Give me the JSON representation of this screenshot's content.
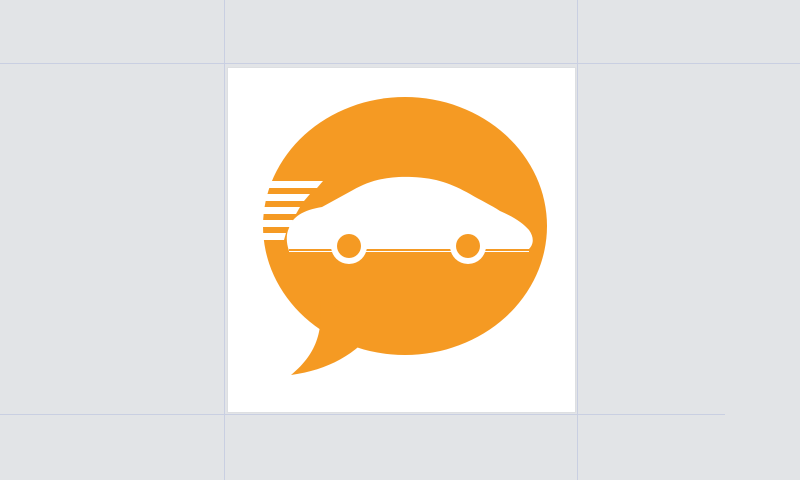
{
  "canvas": {
    "background_color": "#e2e4e7",
    "guide_color": "#c9cfe2"
  },
  "asset": {
    "name": "car chat logo",
    "icon": "car-speech-bubble-icon",
    "frame_color": "#ffffff",
    "brand_color": "#f59a23",
    "car_color": "#ffffff"
  }
}
